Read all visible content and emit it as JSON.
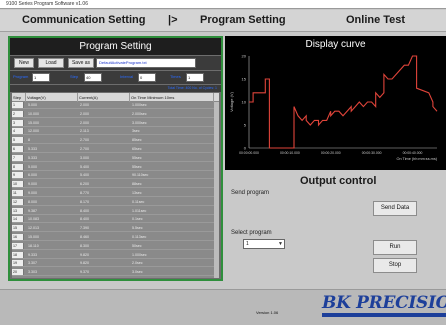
{
  "window": {
    "title": "9100 Series Program Software v1.06"
  },
  "tabs": [
    {
      "label": "Communication Setting"
    },
    {
      "label": "|>"
    },
    {
      "label": "Program Setting"
    },
    {
      "label": "Online Test"
    }
  ],
  "program_setting": {
    "title": "Program Setting",
    "buttons": {
      "new": "New",
      "load": "Load",
      "save_as": "Save as"
    },
    "filename": "DefaultActivateProgram.txt",
    "params": [
      {
        "label": "Program",
        "value": "1"
      },
      {
        "label": "Step",
        "value": "40"
      },
      {
        "label": "Interval",
        "value": "0"
      },
      {
        "label": "Times",
        "value": "1"
      }
    ],
    "info": "Total Time: 400  No. of Cycles: 1"
  },
  "grid": {
    "columns": [
      "Step",
      "Voltage(V)",
      "Current(A)",
      "On Time Minimum 10ms"
    ],
    "rows": [
      {
        "n": "1",
        "v": "5.000",
        "c": "2.000",
        "t": "1.000sec"
      },
      {
        "n": "2",
        "v": "10.000",
        "c": "2.000",
        "t": "2.000sec"
      },
      {
        "n": "3",
        "v": "15.000",
        "c": "2.000",
        "t": "3.000sec"
      },
      {
        "n": "4",
        "v": "12.000",
        "c": "2.113",
        "t": "3sec"
      },
      {
        "n": "5",
        "v": "8",
        "c": "2.700",
        "t": "85sec"
      },
      {
        "n": "6",
        "v": "5.333",
        "c": "2.700",
        "t": "65sec"
      },
      {
        "n": "7",
        "v": "5.333",
        "c": "3.000",
        "t": "55sec"
      },
      {
        "n": "8",
        "v": "5.000",
        "c": "5.400",
        "t": "55sec"
      },
      {
        "n": "9",
        "v": "6.000",
        "c": "5.400",
        "t": "90.110sec"
      },
      {
        "n": "10",
        "v": "9.000",
        "c": "6.200",
        "t": "88sec"
      },
      {
        "n": "11",
        "v": "9.000",
        "c": "8.770",
        "t": "13sec"
      },
      {
        "n": "12",
        "v": "8.000",
        "c": "8.170",
        "t": "0.11sec"
      },
      {
        "n": "13",
        "v": "9.387",
        "c": "8.400",
        "t": "1.011sec"
      },
      {
        "n": "14",
        "v": "10.083",
        "c": "8.400",
        "t": "0.1sec"
      },
      {
        "n": "15",
        "v": "12.013",
        "c": "7.390",
        "t": "5.5sec"
      },
      {
        "n": "16",
        "v": "15.000",
        "c": "8.460",
        "t": "0.113sec"
      },
      {
        "n": "17",
        "v": "18.110",
        "c": "8.300",
        "t": "50sec"
      },
      {
        "n": "18",
        "v": "9.333",
        "c": "9.820",
        "t": "1.000sec"
      },
      {
        "n": "19",
        "v": "3.307",
        "c": "9.820",
        "t": "2.0sec"
      },
      {
        "n": "20",
        "v": "3.303",
        "c": "9.370",
        "t": "3.0sec"
      }
    ]
  },
  "display_curve": {
    "title": "Display curve",
    "ylabel": "Voltage (V)",
    "xlabel": "On Time (hh:mm:ss.ms)",
    "yticks": [
      "20",
      "15",
      "10",
      "5",
      "0"
    ],
    "xticks": [
      "00:00:00.000",
      "00:00:10.000",
      "00:00:20.000",
      "00:00:30.000",
      "00:00:40.000",
      "00:00:50"
    ],
    "line_color": "#e0443a"
  },
  "chart_data": {
    "type": "line",
    "title": "Display curve",
    "xlabel": "On Time (hh:mm:ss.ms)",
    "ylabel": "Voltage (V)",
    "x": [
      0,
      1,
      1,
      4,
      4,
      5,
      5,
      11,
      11,
      12,
      13,
      14,
      14,
      15,
      16,
      17,
      17,
      18,
      19,
      20,
      20,
      21,
      22,
      23,
      24,
      25,
      25,
      26,
      27,
      28,
      29,
      30,
      31,
      31,
      32,
      33,
      33,
      34,
      35,
      36,
      38,
      39,
      40,
      41,
      41,
      44,
      44,
      45,
      45,
      46
    ],
    "y": [
      10,
      10,
      12,
      12,
      15,
      15,
      0,
      0,
      9,
      7,
      6,
      7,
      6,
      5,
      6,
      6,
      5,
      6,
      6,
      8,
      7,
      8,
      8,
      7,
      8,
      9,
      8,
      9,
      10,
      9,
      10,
      10,
      9,
      12,
      11,
      12,
      16,
      15,
      15,
      16,
      18,
      18,
      20,
      20,
      13,
      12,
      12,
      10,
      9,
      8
    ],
    "ylim": [
      0,
      20
    ],
    "xlim": [
      0,
      46
    ],
    "grid": false
  },
  "output_control": {
    "title": "Output control",
    "send_label": "Send program",
    "send_button": "Send Data",
    "select_label": "Select program",
    "select_value": "1",
    "run_button": "Run",
    "stop_button": "Stop"
  },
  "footer": {
    "version": "Version 1.06",
    "brand": "BK PRECISION"
  }
}
